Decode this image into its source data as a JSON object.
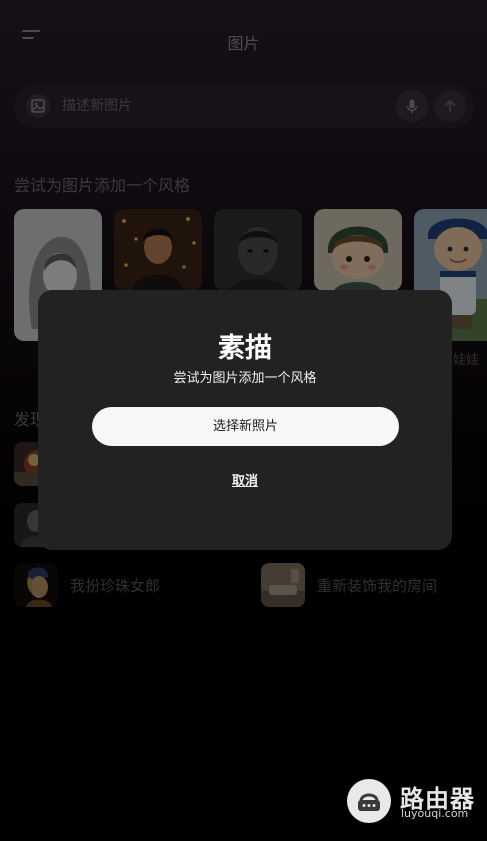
{
  "header": {
    "title": "图片",
    "menu_icon": "menu-icon"
  },
  "search": {
    "placeholder": "描述新图片",
    "image_icon": "image-icon",
    "mic_icon": "microphone-icon",
    "send_icon": "arrow-up-icon"
  },
  "styles_section": {
    "title": "尝试为图片添加一个风格",
    "cards": [
      {
        "name": "sketch"
      },
      {
        "name": "festive-portrait"
      },
      {
        "name": "bw-portrait"
      },
      {
        "name": "cartoon-character"
      },
      {
        "name": "bobblehead",
        "label": "头娃娃"
      }
    ]
  },
  "discover_section": {
    "title": "发现",
    "items": [
      {
        "label": ""
      },
      {
        "label": ""
      },
      {
        "label": "我扮珍珠女郎"
      },
      {
        "label": "重新装饰我的房间"
      }
    ]
  },
  "modal": {
    "title": "素描",
    "subtitle": "尝试为图片添加一个风格",
    "primary_button": "选择新照片",
    "cancel": "取消"
  },
  "watermark": {
    "name": "路由器",
    "url": "luyouqi.com"
  }
}
